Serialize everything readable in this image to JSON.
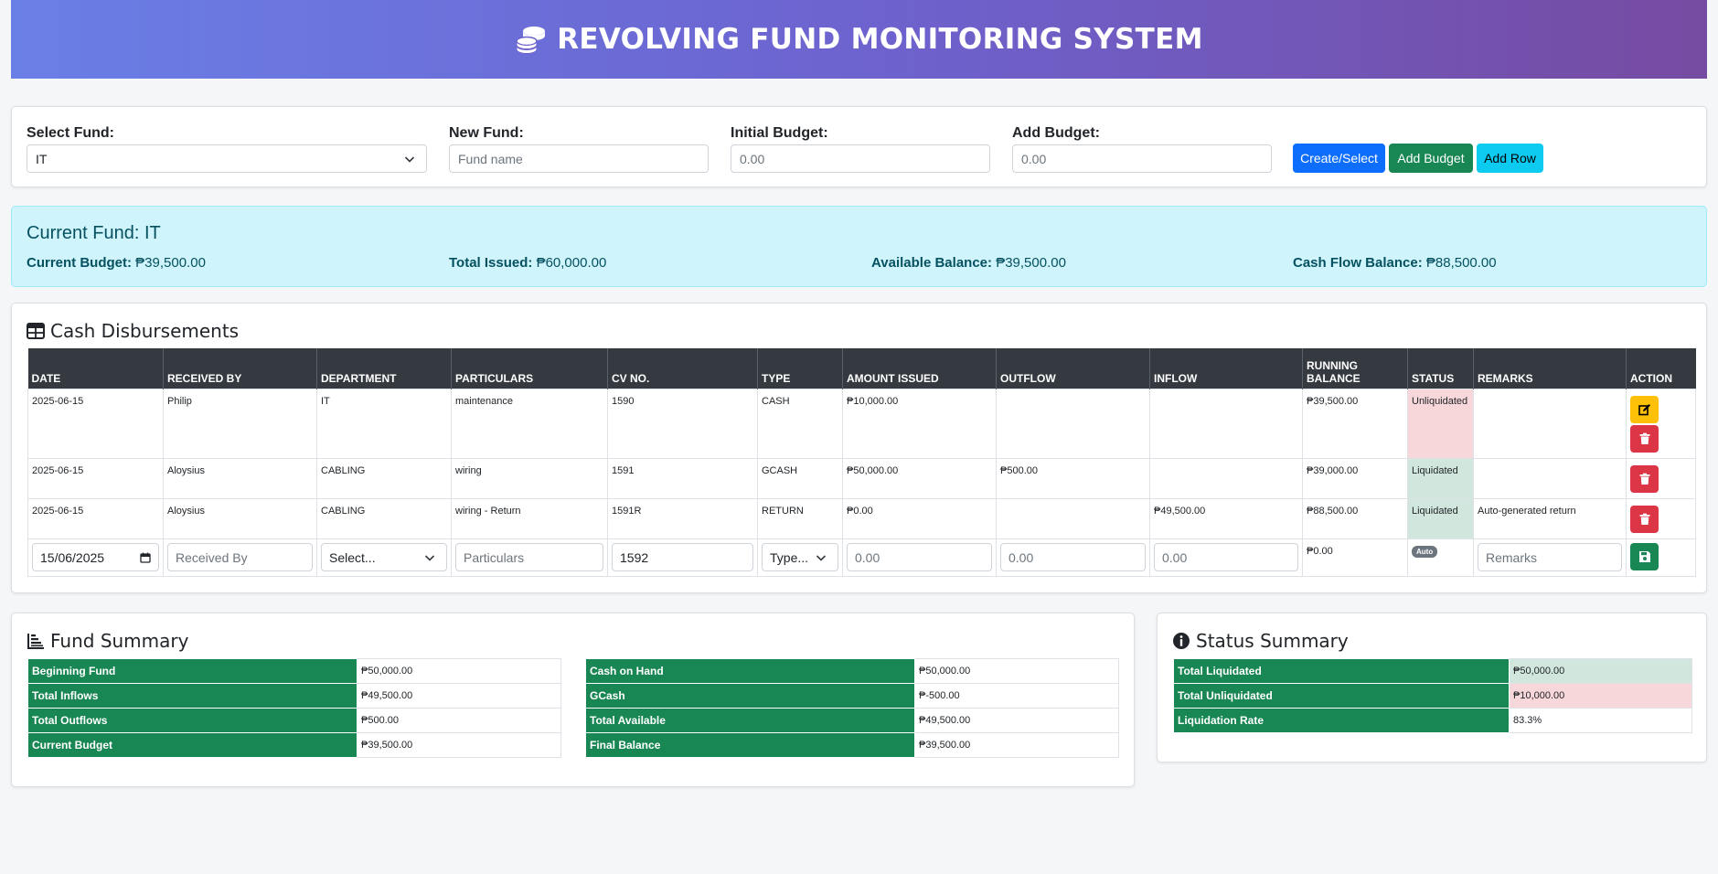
{
  "header": {
    "title": "REVOLVING FUND MONITORING SYSTEM"
  },
  "controls": {
    "select_fund_label": "Select Fund:",
    "select_fund_value": "IT",
    "new_fund_label": "New Fund:",
    "new_fund_placeholder": "Fund name",
    "initial_budget_label": "Initial Budget:",
    "initial_budget_placeholder": "0.00",
    "add_budget_label": "Add Budget:",
    "add_budget_placeholder": "0.00",
    "create_button": "Create/Select",
    "add_budget_button": "Add Budget",
    "add_row_button": "Add Row"
  },
  "current": {
    "title": "Current Fund: IT",
    "budget_label": "Current Budget:",
    "budget_value": "₱39,500.00",
    "issued_label": "Total Issued:",
    "issued_value": "₱60,000.00",
    "available_label": "Available Balance:",
    "available_value": "₱39,500.00",
    "cashflow_label": "Cash Flow Balance:",
    "cashflow_value": "₱88,500.00"
  },
  "disbursements": {
    "title": "Cash Disbursements",
    "columns": [
      "DATE",
      "RECEIVED BY",
      "DEPARTMENT",
      "PARTICULARS",
      "CV NO.",
      "TYPE",
      "AMOUNT ISSUED",
      "OUTFLOW",
      "INFLOW",
      "RUNNING BALANCE",
      "STATUS",
      "REMARKS",
      "ACTION"
    ],
    "rows": [
      {
        "date": "2025-06-15",
        "received_by": "Philip",
        "department": "IT",
        "particulars": "maintenance",
        "cv_no": "1590",
        "type": "CASH",
        "amount": "₱10,000.00",
        "outflow": "",
        "inflow": "",
        "balance": "₱39,500.00",
        "status": "Unliquidated",
        "remarks": ""
      },
      {
        "date": "2025-06-15",
        "received_by": "Aloysius",
        "department": "CABLING",
        "particulars": "wiring",
        "cv_no": "1591",
        "type": "GCASH",
        "amount": "₱50,000.00",
        "outflow": "₱500.00",
        "inflow": "",
        "balance": "₱39,000.00",
        "status": "Liquidated",
        "remarks": ""
      },
      {
        "date": "2025-06-15",
        "received_by": "Aloysius",
        "department": "CABLING",
        "particulars": "wiring - Return",
        "cv_no": "1591R",
        "type": "RETURN",
        "amount": "₱0.00",
        "outflow": "",
        "inflow": "₱49,500.00",
        "balance": "₱88,500.00",
        "status": "Liquidated",
        "remarks": "Auto-generated return"
      }
    ],
    "new_row": {
      "date": "15/06/2025",
      "received_by_placeholder": "Received By",
      "department_placeholder": "Select...",
      "particulars_placeholder": "Particulars",
      "cv_no": "1592",
      "type_placeholder": "Type...",
      "amount_placeholder": "0.00",
      "outflow_placeholder": "0.00",
      "inflow_placeholder": "0.00",
      "balance": "₱0.00",
      "status_badge": "Auto",
      "remarks_placeholder": "Remarks"
    }
  },
  "fund_summary": {
    "title": "Fund Summary",
    "left": [
      {
        "label": "Beginning Fund",
        "value": "₱50,000.00"
      },
      {
        "label": "Total Inflows",
        "value": "₱49,500.00"
      },
      {
        "label": "Total Outflows",
        "value": "₱500.00"
      },
      {
        "label": "Current Budget",
        "value": "₱39,500.00"
      }
    ],
    "right": [
      {
        "label": "Cash on Hand",
        "value": "₱50,000.00"
      },
      {
        "label": "GCash",
        "value": "₱-500.00"
      },
      {
        "label": "Total Available",
        "value": "₱49,500.00"
      },
      {
        "label": "Final Balance",
        "value": "₱39,500.00"
      }
    ]
  },
  "status_summary": {
    "title": "Status Summary",
    "rows": [
      {
        "label": "Total Liquidated",
        "value": "₱50,000.00"
      },
      {
        "label": "Total Unliquidated",
        "value": "₱10,000.00"
      },
      {
        "label": "Liquidation Rate",
        "value": "83.3%"
      }
    ]
  },
  "colors": {
    "header_gradient_start": "#6a7fe6",
    "header_gradient_end": "#764ba2",
    "table_header": "#343a40",
    "summary_key": "#198754",
    "liquidated": "#d1e7dd",
    "unliquidated": "#f8d7da"
  },
  "icons": [
    "coins-icon",
    "table-icon",
    "chart-icon",
    "info-icon",
    "edit-icon",
    "trash-icon",
    "save-icon"
  ]
}
